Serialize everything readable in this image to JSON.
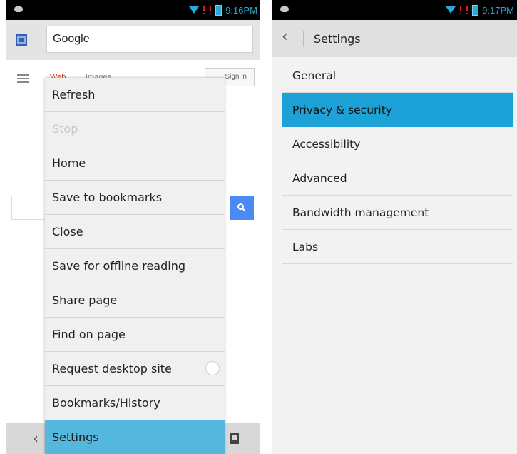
{
  "left_screen": {
    "status": {
      "time": "9:16PM"
    },
    "url_bar": {
      "text": "Google"
    },
    "google_page": {
      "tab_web": "Web",
      "tab_images": "Images",
      "sign_in": "Sign in"
    },
    "menu": {
      "items": [
        {
          "label": "Refresh",
          "state": "normal"
        },
        {
          "label": "Stop",
          "state": "disabled"
        },
        {
          "label": "Home",
          "state": "normal"
        },
        {
          "label": "Save to bookmarks",
          "state": "normal"
        },
        {
          "label": "Close",
          "state": "normal"
        },
        {
          "label": "Save for offline reading",
          "state": "normal"
        },
        {
          "label": "Share page",
          "state": "normal"
        },
        {
          "label": "Find on page",
          "state": "normal"
        },
        {
          "label": "Request desktop site",
          "state": "toggle-off"
        },
        {
          "label": "Bookmarks/History",
          "state": "normal"
        },
        {
          "label": "Settings",
          "state": "highlighted"
        }
      ]
    }
  },
  "right_screen": {
    "status": {
      "time": "9:17PM"
    },
    "action_bar": {
      "title": "Settings"
    },
    "settings_items": [
      {
        "label": "General"
      },
      {
        "label": "Privacy & security",
        "selected": true
      },
      {
        "label": "Accessibility"
      },
      {
        "label": "Advanced"
      },
      {
        "label": "Bandwidth management"
      },
      {
        "label": "Labs"
      }
    ]
  },
  "colors": {
    "menu_highlight": "#55b7dd",
    "settings_selected": "#1da2d8",
    "status_icons": "#2aa8d8",
    "search_button": "#4a8af4"
  }
}
